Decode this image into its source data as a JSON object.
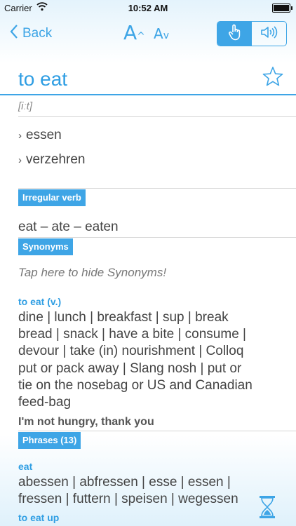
{
  "status": {
    "carrier": "Carrier",
    "time": "10:52 AM",
    "battery_level": 1.0
  },
  "nav": {
    "back_label": "Back",
    "font_larger_label": "A",
    "font_smaller_label": "A",
    "icons": {
      "back": "chevron-left-icon",
      "touch": "hand-pointer-icon",
      "audio": "speaker-icon",
      "favorite": "star-icon",
      "loading": "hourglass-icon"
    }
  },
  "entry": {
    "headword": "to eat",
    "pronunciation": "[iːt]",
    "translations": [
      "essen",
      "verzehren"
    ],
    "irregular_label": "Irregular verb",
    "irregular_forms": "eat – ate – eaten",
    "synonyms_label": "Synonyms",
    "synonyms_hint": "Tap here to hide Synonyms!",
    "synonym_group_label": "to eat (v.)",
    "synonym_lines": [
      "dine | lunch | breakfast | sup | break",
      "bread | snack | have a bite | consume |",
      "devour | take (in) nourishment | Colloq",
      "put or pack away | Slang nosh | put or",
      "tie on the nosebag or US and Canadian",
      "feed-bag"
    ],
    "example": "I'm not hungry, thank you",
    "phrases_label": "Phrases (13)",
    "phrase_group_label": "eat",
    "phrase_lines": [
      "abessen | abfressen | esse | essen |",
      "fressen | futtern | speisen | wegessen"
    ],
    "phrase_group2_label": "to eat up"
  },
  "colors": {
    "accent": "#3ea5e6",
    "text": "#444444"
  }
}
